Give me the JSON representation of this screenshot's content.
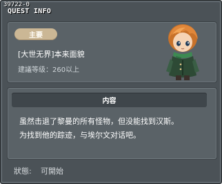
{
  "quest_id": "39722-0",
  "window_title": "QUEST INFO",
  "category_badge": "主要",
  "quest_name": "[大世无界]本来面貌",
  "required_level": "建議等级：260以上",
  "content_header": "内容",
  "description_lines": [
    "虽然击退了黎曼的所有怪物，但没能找到汉斯。",
    "为找到他的踪迹，与埃尔文对话吧。"
  ],
  "status": {
    "label": "狀態:",
    "value": "可開始"
  },
  "npc_portrait_icon": "npc-portrait-icon",
  "colors": {
    "window_bg": "#4b5257",
    "panel_bg": "#5a6267",
    "badge_bg": "#cbb795",
    "header_bg": "#3f464b"
  }
}
